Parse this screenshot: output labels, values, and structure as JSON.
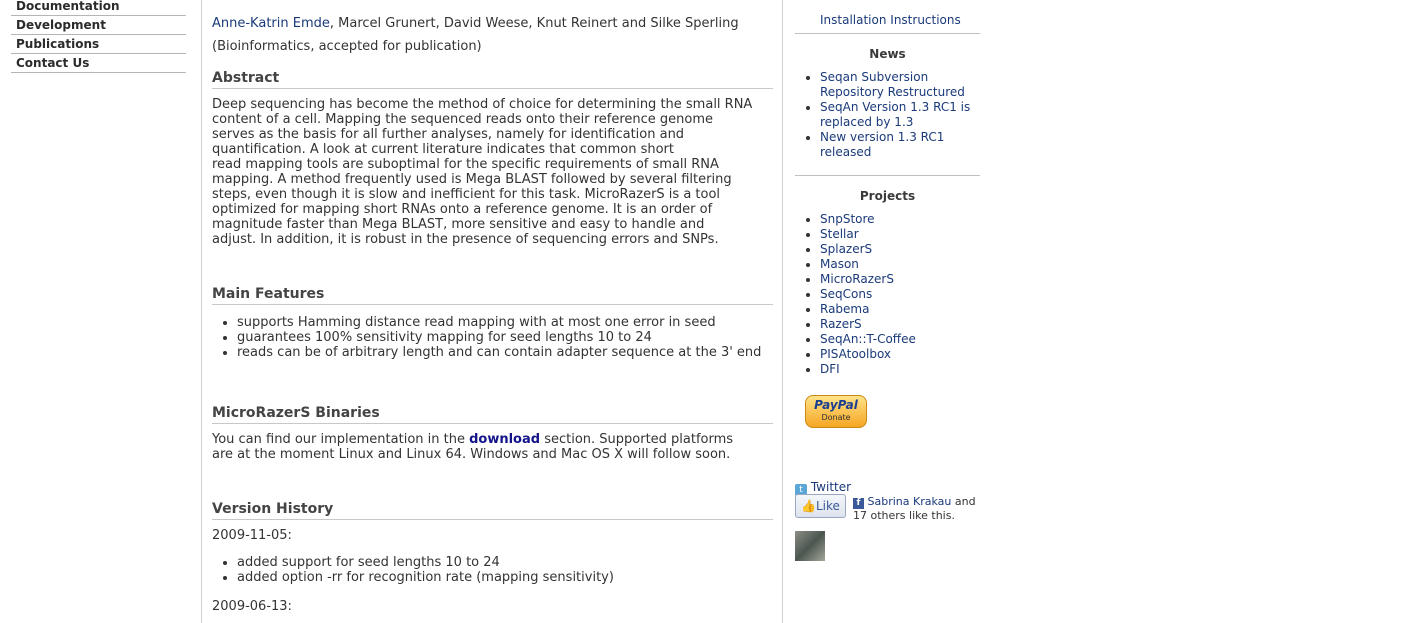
{
  "nav": {
    "items": [
      {
        "label": "Documentation"
      },
      {
        "label": "Development"
      },
      {
        "label": "Publications"
      },
      {
        "label": "Contact Us"
      }
    ]
  },
  "main": {
    "first_author": "Anne-Katrin Emde",
    "other_authors": ", Marcel Grunert, David Weese, Knut Reinert and Silke Sperling",
    "pub_note": "(Bioinformatics, accepted for publication)",
    "abstract_heading": "Abstract",
    "abstract_lines": [
      "Deep sequencing has become the method of choice for determining the small RNA",
      "content of a cell. Mapping the sequenced reads onto their reference genome",
      "serves as the basis for all further analyses, namely for identification and",
      "quantification. A look at current literature indicates that common short",
      "read mapping tools are suboptimal for the specific requirements of small RNA",
      "mapping. A method frequently used is Mega BLAST followed by several filtering",
      "steps, even though it is slow and inefficient for this task. MicroRazerS is a tool",
      "optimized for mapping short RNAs onto a reference genome. It is an order of",
      "magnitude faster than Mega BLAST, more sensitive and easy to handle and",
      "adjust. In addition, it is robust in the presence of sequencing errors and SNPs."
    ],
    "features_heading": "Main Features",
    "features": [
      "supports Hamming distance read mapping with at most one error in seed",
      "guarantees 100% sensitivity mapping for seed lengths 10 to 24",
      "reads can be of arbitrary length and can contain adapter sequence at the 3' end"
    ],
    "binaries_heading": "MicroRazerS Binaries",
    "binaries_pre": "You can find our implementation in the ",
    "binaries_link": "download",
    "binaries_post": " section. Supported platforms",
    "binaries_line2": "are at the moment Linux and Linux 64. Windows and Mac OS X will follow soon.",
    "history_heading": "Version History",
    "history_date1": "2009-11-05:",
    "history_items1": [
      "added support for seed lengths 10 to 24",
      "added option -rr for recognition rate (mapping sensitivity)"
    ],
    "history_date2": "2009-06-13:"
  },
  "sidebar": {
    "install_link": "Installation Instructions",
    "news_heading": "News",
    "news": [
      [
        "Seqan Subversion",
        "Repository Restructured"
      ],
      [
        "SeqAn Version 1.3 RC1 is",
        "replaced by 1.3"
      ],
      [
        "New version 1.3 RC1",
        "released"
      ]
    ],
    "projects_heading": "Projects",
    "projects": [
      "SnpStore",
      "Stellar",
      "SplazerS",
      "Mason",
      "MicroRazerS",
      "SeqCons",
      "Rabema",
      "RazerS",
      "SeqAn::T-Coffee",
      "PISAtoolbox",
      "DFI"
    ],
    "paypal_logo": "PayPal",
    "paypal_label": "Donate",
    "twitter_label": "Twitter",
    "like_label": "Like",
    "fb_name": "Sabrina Krakau",
    "fb_rest_1": " and",
    "fb_rest_2": "17 others like this."
  }
}
